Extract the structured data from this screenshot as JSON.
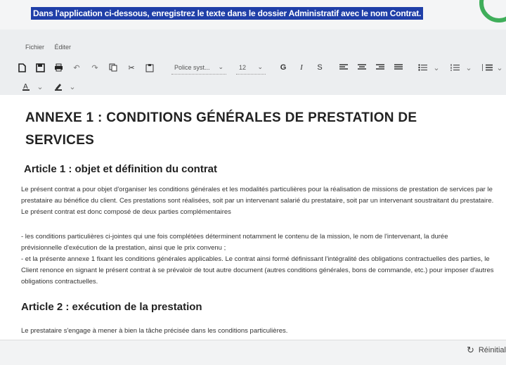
{
  "instruction": "Dans l'application ci-dessous, enregistrez le texte dans le dossier Administratif avec le nom Contrat.",
  "menu": {
    "file": "Fichier",
    "edit": "Éditer"
  },
  "toolbar": {
    "font_family": "Police syst...",
    "font_size": "12",
    "bold": "G",
    "italic": "I",
    "strike": "S",
    "icons": [
      "new-document-icon",
      "save-icon",
      "print-icon",
      "undo-icon",
      "redo-icon",
      "copy-icon",
      "cut-icon",
      "paste-icon"
    ]
  },
  "document": {
    "title": "ANNEXE 1 : CONDITIONS GÉNÉRALES DE PRESTATION DE SERVICES",
    "article1_heading": "Article 1 : objet et définition du contrat",
    "article1_para1": "Le présent contrat a pour objet d'organiser les conditions générales et les modalités particulières pour la réalisation de missions de prestation de services par le prestataire au bénéfice du client. Ces prestations sont réalisées, soit par un intervenant salarié du prestataire, soit par un intervenant soustraitant du prestataire. Le présent contrat est donc composé de deux parties complémentaires",
    "article1_para2": "- les conditions particulières ci-jointes qui une fois complétées déterminent notamment le contenu de la mission, le nom de l'intervenant, la durée prévisionnelle d'exécution de la prestation, ainsi que le prix convenu ;",
    "article1_para3": "- et la présente annexe 1 fixant les conditions générales applicables. Le contrat ainsi formé définissant l'intégralité des obligations contractuelles des parties, le Client renonce en signant le présent contrat à se prévaloir de tout autre document (autres conditions générales, bons de commande, etc.) pour imposer d'autres obligations contractuelles.",
    "article2_heading": "Article 2 : exécution de la prestation",
    "article2_para1": "Le prestataire s'engage à mener à bien la tâche précisée dans les conditions particulières."
  },
  "footer": {
    "reset_label": "Réinitial"
  }
}
